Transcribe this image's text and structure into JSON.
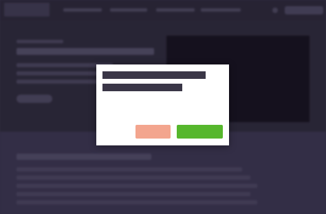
{
  "colors": {
    "page_background": "#37324a",
    "topbar": "#2b2839",
    "hero_background": "#2d2a3b",
    "hero_media": "#15121f",
    "modal_background": "#ffffff",
    "modal_text_placeholder": "#3a3647",
    "cancel_button": "#f3a58e",
    "confirm_button": "#56b72c"
  },
  "background_page": {
    "topbar": {
      "logo": "",
      "nav_items": [
        "",
        "",
        "",
        ""
      ],
      "action_icon": "user-icon",
      "cta_label": ""
    },
    "hero": {
      "eyebrow": "",
      "title": "",
      "body": [
        "",
        "",
        ""
      ],
      "button_label": "",
      "media": "image-placeholder"
    },
    "content": {
      "heading": "",
      "paragraph_lines": [
        "",
        "",
        "",
        "",
        ""
      ]
    }
  },
  "modal": {
    "message_lines": [
      "",
      ""
    ],
    "cancel_button_label": "",
    "confirm_button_label": ""
  }
}
